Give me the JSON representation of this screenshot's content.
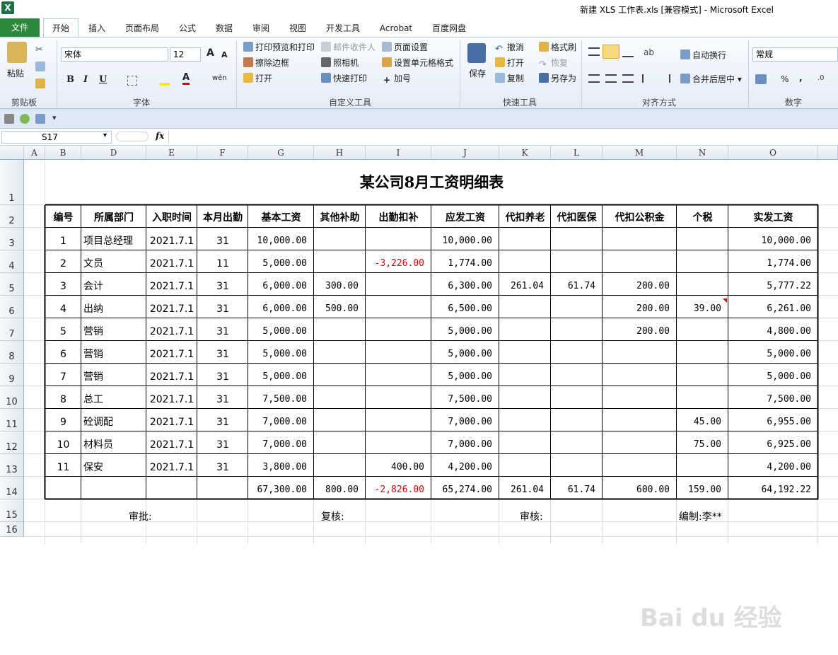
{
  "window": {
    "title": "新建 XLS 工作表.xls  [兼容模式] - Microsoft Excel",
    "app_icon": "X"
  },
  "tabs": {
    "file": "文件",
    "home": "开始",
    "insert": "插入",
    "layout": "页面布局",
    "formula": "公式",
    "data": "数据",
    "review": "审阅",
    "view": "视图",
    "dev": "开发工具",
    "acrobat": "Acrobat",
    "baidu": "百度网盘"
  },
  "ribbon": {
    "clipboard": {
      "paste": "粘贴",
      "label": "剪贴板"
    },
    "font": {
      "name": "宋体",
      "size": "12",
      "label": "字体",
      "bold": "B",
      "italic": "I",
      "underline": "U",
      "grow": "A",
      "shrink": "A",
      "color_a": "A",
      "phonetic": "wén"
    },
    "custom": {
      "print_preview": "打印预览和打印",
      "mail": "邮件收件人",
      "page_setup": "页面设置",
      "erase_border": "擦除边框",
      "camera": "照相机",
      "cell_format": "设置单元格格式",
      "open": "打开",
      "quick_print": "快速打印",
      "plus": "加号",
      "label": "自定义工具"
    },
    "quick": {
      "save": "保存",
      "undo": "撤消",
      "format_painter": "格式刷",
      "open": "打开",
      "redo": "恢复",
      "copy": "复制",
      "save_as": "另存为",
      "label": "快速工具"
    },
    "align": {
      "wrap": "自动换行",
      "merge": "合并后居中",
      "label": "对齐方式"
    },
    "number": {
      "format": "常规",
      "percent": "%",
      "comma": ",",
      "label": "数字"
    }
  },
  "formula_bar": {
    "name_box": "S17",
    "fx": "fx",
    "value": ""
  },
  "columns": [
    "A",
    "B",
    "D",
    "E",
    "F",
    "G",
    "H",
    "I",
    "J",
    "K",
    "L",
    "M",
    "N",
    "O"
  ],
  "rows": [
    "1",
    "2",
    "3",
    "4",
    "5",
    "6",
    "7",
    "8",
    "9",
    "10",
    "11",
    "12",
    "13",
    "14",
    "15",
    "16"
  ],
  "sheet": {
    "title": "某公司8月工资明细表",
    "headers": [
      "编号",
      "所属部门",
      "入职时间",
      "本月出勤",
      "基本工资",
      "其他补助",
      "出勤扣补",
      "应发工资",
      "代扣养老",
      "代扣医保",
      "代扣公积金",
      "个税",
      "实发工资"
    ],
    "records": [
      [
        "1",
        "项目总经理",
        "2021.7.1",
        "31",
        "10,000.00",
        "",
        "",
        "10,000.00",
        "",
        "",
        "",
        "",
        "10,000.00"
      ],
      [
        "2",
        "文员",
        "2021.7.1",
        "11",
        "5,000.00",
        "",
        "-3,226.00",
        "1,774.00",
        "",
        "",
        "",
        "",
        "1,774.00"
      ],
      [
        "3",
        "会计",
        "2021.7.1",
        "31",
        "6,000.00",
        "300.00",
        "",
        "6,300.00",
        "261.04",
        "61.74",
        "200.00",
        "",
        "5,777.22"
      ],
      [
        "4",
        "出纳",
        "2021.7.1",
        "31",
        "6,000.00",
        "500.00",
        "",
        "6,500.00",
        "",
        "",
        "200.00",
        "39.00",
        "6,261.00"
      ],
      [
        "5",
        "营销",
        "2021.7.1",
        "31",
        "5,000.00",
        "",
        "",
        "5,000.00",
        "",
        "",
        "200.00",
        "",
        "4,800.00"
      ],
      [
        "6",
        "营销",
        "2021.7.1",
        "31",
        "5,000.00",
        "",
        "",
        "5,000.00",
        "",
        "",
        "",
        "",
        "5,000.00"
      ],
      [
        "7",
        "营销",
        "2021.7.1",
        "31",
        "5,000.00",
        "",
        "",
        "5,000.00",
        "",
        "",
        "",
        "",
        "5,000.00"
      ],
      [
        "8",
        "总工",
        "2021.7.1",
        "31",
        "7,500.00",
        "",
        "",
        "7,500.00",
        "",
        "",
        "",
        "",
        "7,500.00"
      ],
      [
        "9",
        "砼调配",
        "2021.7.1",
        "31",
        "7,000.00",
        "",
        "",
        "7,000.00",
        "",
        "",
        "",
        "45.00",
        "6,955.00"
      ],
      [
        "10",
        "材料员",
        "2021.7.1",
        "31",
        "7,000.00",
        "",
        "",
        "7,000.00",
        "",
        "",
        "",
        "75.00",
        "6,925.00"
      ],
      [
        "11",
        "保安",
        "2021.7.1",
        "31",
        "3,800.00",
        "",
        "400.00",
        "4,200.00",
        "",
        "",
        "",
        "",
        "4,200.00"
      ]
    ],
    "totals": [
      "",
      "",
      "",
      "",
      "67,300.00",
      "800.00",
      "-2,826.00",
      "65,274.00",
      "261.04",
      "61.74",
      "600.00",
      "159.00",
      "64,192.22"
    ],
    "footer": {
      "approve": "审批:",
      "recheck": "复核:",
      "audit": "审核:",
      "prepared": "编制:李**"
    }
  },
  "watermark": "Bai du 经验",
  "colors": {
    "file_tab": "#2a8a3a",
    "negative": "#e00000"
  }
}
